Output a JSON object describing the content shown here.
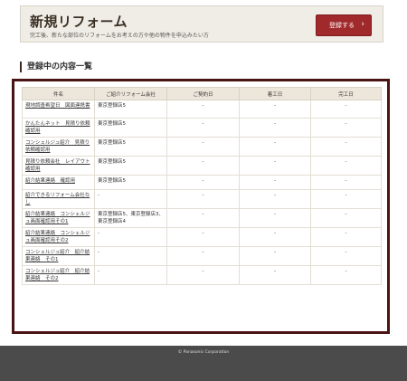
{
  "banner": {
    "title": "新規リフォーム",
    "description": "完工後、新たな部位のリフォームをお考えの方や他の物件を申込みたい方",
    "register_label": "登録する",
    "chevron": "›"
  },
  "section_title": "登録中の内容一覧",
  "table": {
    "headers": [
      "件名",
      "ご紹介リフォーム会社",
      "ご契約日",
      "着工日",
      "完工日"
    ],
    "rows": [
      {
        "name": "現地調査希望日　図面連携書",
        "company": "東京登録店5",
        "contract": "-",
        "start": "-",
        "finish": "-"
      },
      {
        "name": "かんたんネット　見積り依頼確認用",
        "company": "東京登録店5",
        "contract": "-",
        "start": "-",
        "finish": "-"
      },
      {
        "name": "コンシェルジュ紹介　見積り依頼確認用",
        "company": "東京登録店5",
        "contract": "-",
        "start": "-",
        "finish": "-"
      },
      {
        "name": "見積り依頼会社　レイアウト確認用",
        "company": "東京登録店5",
        "contract": "-",
        "start": "-",
        "finish": "-"
      },
      {
        "name": "紹介結果連絡　確認用",
        "company": "東京登録店5",
        "contract": "-",
        "start": "-",
        "finish": "-"
      },
      {
        "name": "紹介できるリフォーム会社なし",
        "company": "-",
        "contract": "-",
        "start": "-",
        "finish": "-"
      },
      {
        "name": "紹介結果連絡　コンシェルジュ画面確認用その1",
        "company": "東京登録店5、東京登録店3、東京登録店4",
        "contract": "-",
        "start": "-",
        "finish": "-"
      },
      {
        "name": "紹介結果連絡　コンシェルジュ画面確認用その2",
        "company": "-",
        "contract": "-",
        "start": "-",
        "finish": "-"
      },
      {
        "name": "コンシェルジュ紹介　紹介結果連絡　その1",
        "company": "-",
        "contract": "-",
        "start": "-",
        "finish": "-"
      },
      {
        "name": "コンシェルジュ紹介　紹介結果連絡　その2",
        "company": "-",
        "contract": "-",
        "start": "-",
        "finish": "-"
      }
    ]
  },
  "footer": {
    "copyright": "© Panasonic Corporation"
  }
}
